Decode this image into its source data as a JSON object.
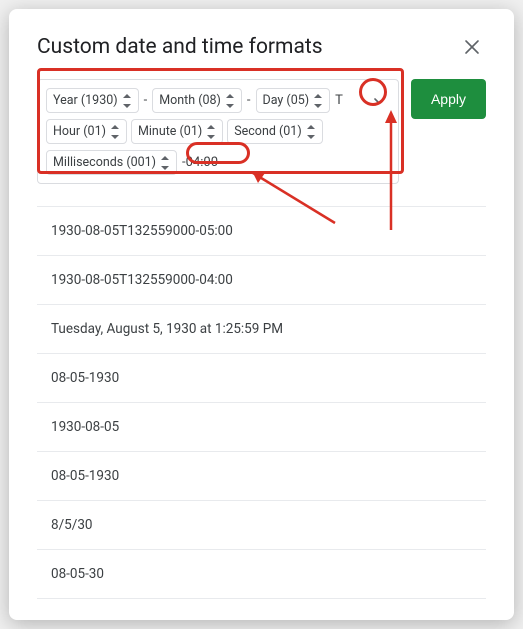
{
  "dialog": {
    "title": "Custom date and time formats",
    "apply_label": "Apply"
  },
  "tokens": {
    "year": "Year (1930)",
    "month": "Month (08)",
    "day": "Day (05)",
    "hour": "Hour (01)",
    "minute": "Minute (01)",
    "second": "Second (01)",
    "ms": "Milliseconds (001)",
    "sep_dash": "-",
    "sep_T": "T",
    "tz_text": "-04:00"
  },
  "examples": [
    "1930-08-05T132559000-05:00",
    "1930-08-05T132559000-04:00",
    "Tuesday, August 5, 1930 at 1:25:59 PM",
    "08-05-1930",
    "1930-08-05",
    "08-05-1930",
    "8/5/30",
    "08-05-30"
  ]
}
